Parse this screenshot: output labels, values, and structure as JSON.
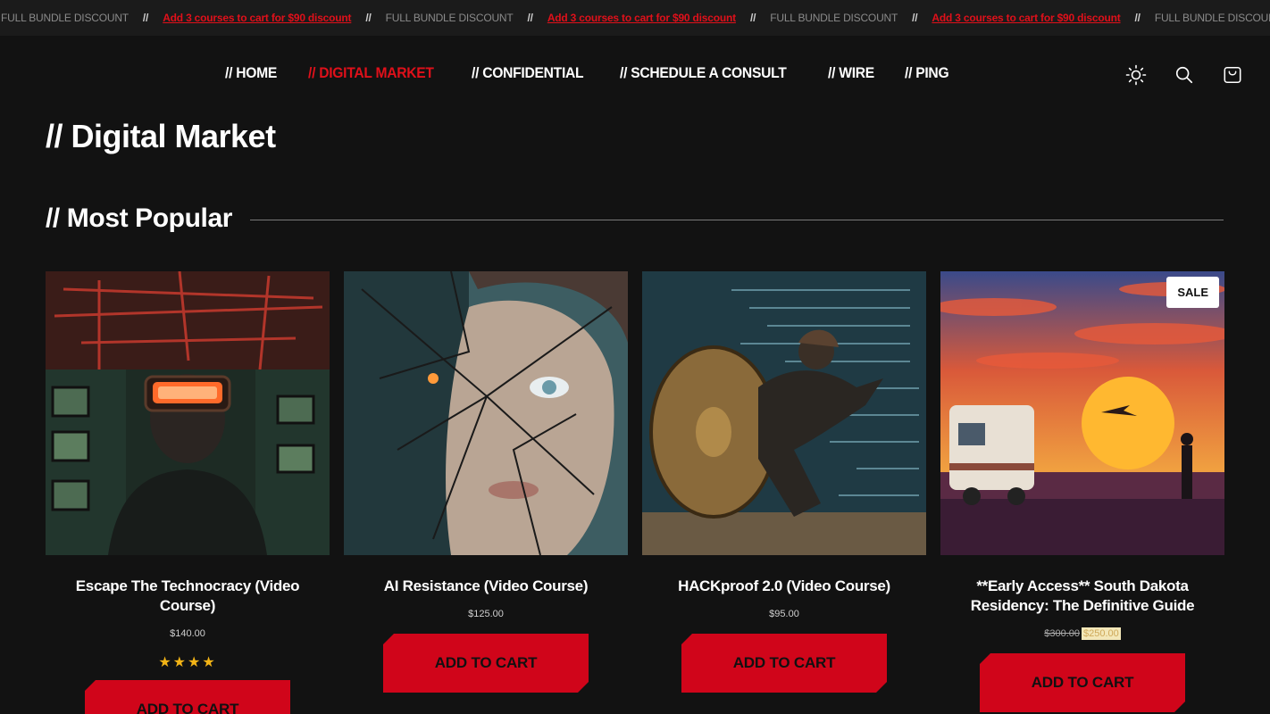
{
  "ticker": {
    "plain": "FULL BUNDLE DISCOUNT",
    "separator": "//",
    "link": "Add 3 courses to cart for $90 discount"
  },
  "nav": {
    "items": [
      {
        "label": "// HOME"
      },
      {
        "label": "// DIGITAL MARKET",
        "active": true
      },
      {
        "label": "// CONFIDENTIAL"
      },
      {
        "label": "// SCHEDULE A CONSULT"
      },
      {
        "label": "// WIRE"
      },
      {
        "label": "// PING"
      }
    ]
  },
  "header_icons": [
    "sun-icon",
    "search-icon",
    "cart-icon"
  ],
  "page_title": "// Digital Market",
  "section_title": "// Most Popular",
  "products": [
    {
      "name": "Escape The Technocracy (Video Course)",
      "price": "$140.00",
      "stars": "★★★★",
      "rating": 4,
      "button": "ADD TO CART"
    },
    {
      "name": "AI Resistance (Video Course)",
      "price": "$125.00",
      "button": "ADD TO CART"
    },
    {
      "name": "HACKproof 2.0 (Video Course)",
      "price": "$95.00",
      "button": "ADD TO CART"
    },
    {
      "name": "**Early Access** South Dakota Residency: The Definitive Guide",
      "old_price": "$300.00",
      "new_price": "$250.00",
      "badge": "SALE",
      "button": "ADD TO CART"
    }
  ],
  "colors": {
    "accent": "#d0051a",
    "background": "#121212",
    "star": "#f3b416"
  }
}
